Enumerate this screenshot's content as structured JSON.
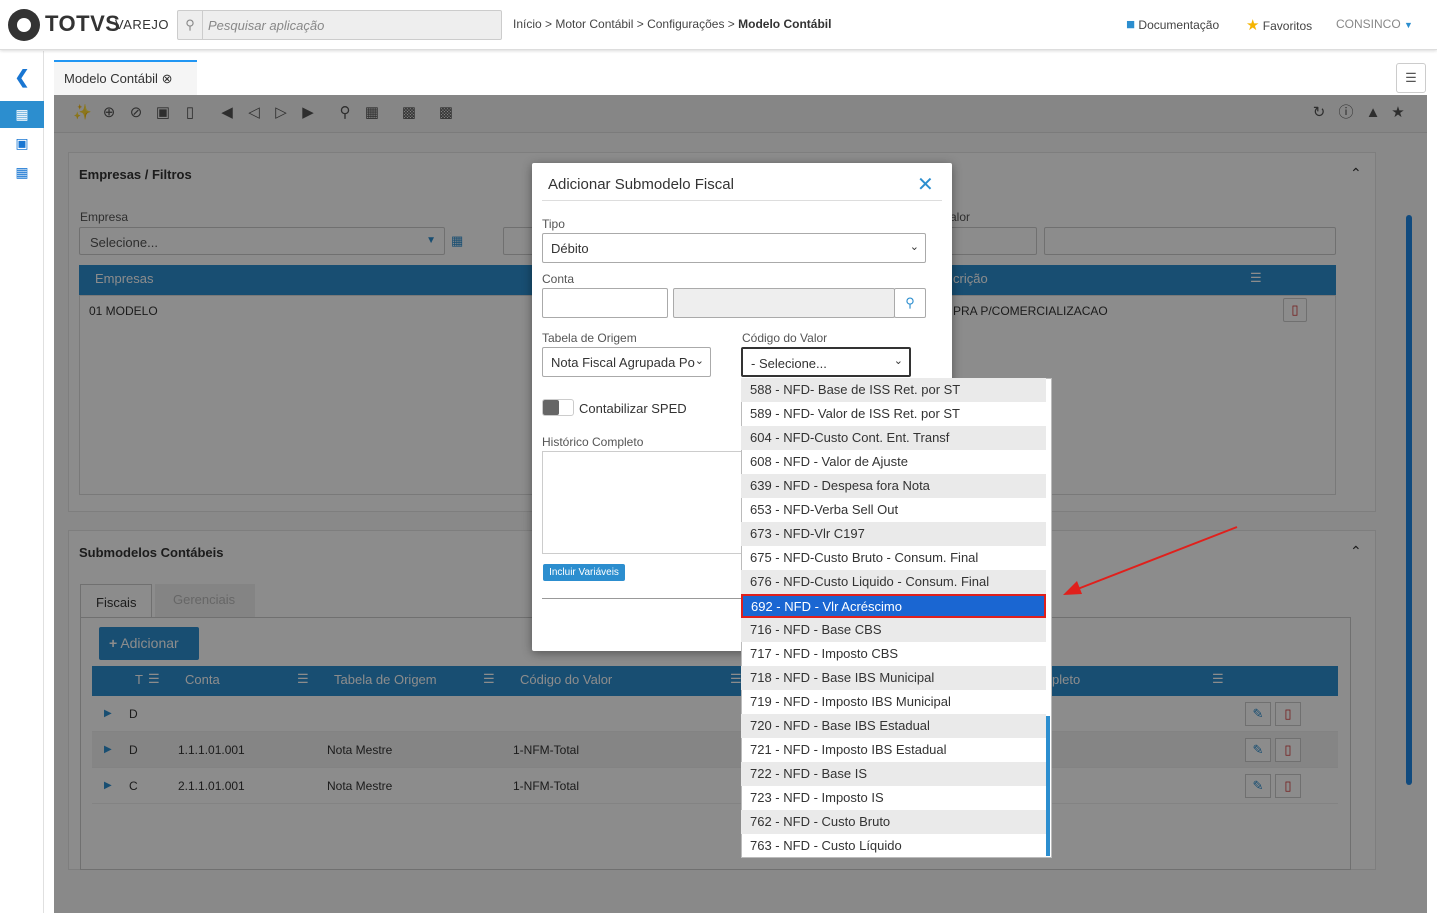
{
  "app": {
    "brand": "TOTVS",
    "brand_sub": "VAREJO"
  },
  "search": {
    "placeholder": "Pesquisar aplicação"
  },
  "breadcrumb": {
    "path": "Início > Motor Contábil > Configurações > ",
    "current": "Modelo Contábil"
  },
  "header": {
    "doc_label": "Documentação",
    "fav_label": "Favoritos",
    "user": "CONSINCO"
  },
  "tab": {
    "label": "Modelo Contábil"
  },
  "empresas": {
    "title": "Empresas / Filtros",
    "empresa_label": "Empresa",
    "empresa_placeholder": "Selecione...",
    "valor_label": "alor",
    "grid_header": "Empresas",
    "grid_header2": "crição",
    "row": {
      "empresa": "01 MODELO",
      "desc": "PRA P/COMERCIALIZACAO"
    }
  },
  "submodelos": {
    "title": "Submodelos Contábeis",
    "tabs": [
      "Fiscais",
      "Gerenciais"
    ],
    "add_label": "Adicionar",
    "columns": [
      "T",
      "Conta",
      "Tabela de Origem",
      "Código do Valor",
      "pleto"
    ],
    "rows": [
      {
        "t": "D",
        "conta": "",
        "tabela": "",
        "codigo": ""
      },
      {
        "t": "D",
        "conta": "1.1.1.01.001",
        "tabela": "Nota Mestre",
        "codigo": "1-NFM-Total"
      },
      {
        "t": "C",
        "conta": "2.1.1.01.001",
        "tabela": "Nota Mestre",
        "codigo": "1-NFM-Total"
      }
    ]
  },
  "modal": {
    "title": "Adicionar Submodelo Fiscal",
    "tipo_label": "Tipo",
    "tipo_value": "Débito",
    "conta_label": "Conta",
    "tabela_label": "Tabela de Origem",
    "tabela_value": "Nota Fiscal Agrupada Po",
    "codigo_label": "Código do Valor",
    "codigo_value": "- Selecione...",
    "sped_label": "Contabilizar SPED",
    "historico_label": "Histórico Completo",
    "incluir_label": "Incluir Variáveis"
  },
  "dropdown": {
    "options": [
      "588 - NFD- Base de ISS Ret. por ST",
      "589 - NFD- Valor de ISS Ret. por ST",
      "604 - NFD-Custo Cont. Ent. Transf",
      "608 - NFD - Valor de Ajuste",
      "639 - NFD - Despesa fora Nota",
      "653 - NFD-Verba Sell Out",
      "673 - NFD-Vlr C197",
      "675 - NFD-Custo Bruto - Consum. Final",
      "676 - NFD-Custo Liquido - Consum. Final",
      "692 - NFD - Vlr Acréscimo",
      "716 - NFD - Base CBS",
      "717 - NFD - Imposto CBS",
      "718 - NFD - Base IBS Municipal",
      "719 - NFD - Imposto IBS Municipal",
      "720 - NFD - Base IBS Estadual",
      "721 - NFD - Imposto IBS Estadual",
      "722 - NFD - Base IS",
      "723 - NFD - Imposto IS",
      "762 - NFD - Custo Bruto",
      "763 - NFD - Custo Líquido"
    ],
    "highlight_color": "#1a66d2",
    "annotation_color": "#e0201c"
  }
}
